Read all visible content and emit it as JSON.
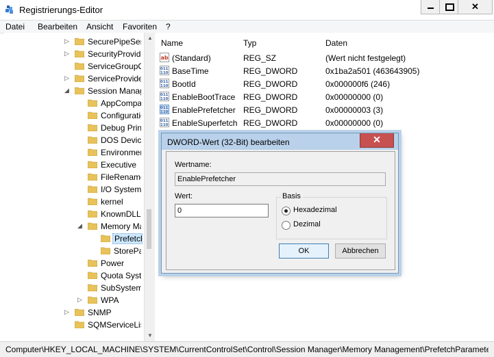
{
  "window": {
    "title": "Registrierungs-Editor",
    "minimize_glyph": "",
    "maximize_glyph": "",
    "close_glyph": "✕"
  },
  "menu": [
    "Datei",
    "Bearbeiten",
    "Ansicht",
    "Favoriten",
    "?"
  ],
  "tree": {
    "items": [
      {
        "label": "SecurePipeServers",
        "expander": "▷"
      },
      {
        "label": "SecurityProviders",
        "expander": "▷"
      },
      {
        "label": "ServiceGroupOrder",
        "expander": ""
      },
      {
        "label": "ServiceProvider",
        "expander": "▷"
      },
      {
        "label": "Session Manager",
        "expander": "◢"
      },
      {
        "label": "AppCompatCache",
        "expander": ""
      },
      {
        "label": "Configuration Manager",
        "expander": ""
      },
      {
        "label": "Debug Print Filter",
        "expander": ""
      },
      {
        "label": "DOS Devices",
        "expander": ""
      },
      {
        "label": "Environment",
        "expander": ""
      },
      {
        "label": "Executive",
        "expander": ""
      },
      {
        "label": "FileRenameOperations",
        "expander": ""
      },
      {
        "label": "I/O System",
        "expander": ""
      },
      {
        "label": "kernel",
        "expander": ""
      },
      {
        "label": "KnownDLLs",
        "expander": ""
      },
      {
        "label": "Memory Management",
        "expander": "◢"
      },
      {
        "label": "PrefetchParameters",
        "expander": ""
      },
      {
        "label": "StoreParameters",
        "expander": ""
      },
      {
        "label": "Power",
        "expander": ""
      },
      {
        "label": "Quota System",
        "expander": ""
      },
      {
        "label": "SubSystems",
        "expander": ""
      },
      {
        "label": "WPA",
        "expander": "▷"
      },
      {
        "label": "SNMP",
        "expander": "▷"
      },
      {
        "label": "SQMServiceList",
        "expander": ""
      }
    ]
  },
  "values_list": {
    "headers": {
      "name": "Name",
      "type": "Typ",
      "data": "Daten"
    },
    "rows": [
      {
        "name": "(Standard)",
        "type": "REG_SZ",
        "data": "(Wert nicht festgelegt)",
        "icon": "string-value-icon"
      },
      {
        "name": "BaseTime",
        "type": "REG_DWORD",
        "data": "0x1ba2a501 (463643905)",
        "icon": "binary-value-icon"
      },
      {
        "name": "BootId",
        "type": "REG_DWORD",
        "data": "0x000000f6 (246)",
        "icon": "binary-value-icon"
      },
      {
        "name": "EnableBootTrace",
        "type": "REG_DWORD",
        "data": "0x00000000 (0)",
        "icon": "binary-value-icon"
      },
      {
        "name": "EnablePrefetcher",
        "type": "REG_DWORD",
        "data": "0x00000003 (3)",
        "icon": "binary-value-icon"
      },
      {
        "name": "EnableSuperfetch",
        "type": "REG_DWORD",
        "data": "0x00000000 (0)",
        "icon": "binary-value-icon"
      }
    ]
  },
  "dialog": {
    "title": "DWORD-Wert (32-Bit) bearbeiten",
    "close_glyph": "✕",
    "name_label": "Wertname:",
    "name_value": "EnablePrefetcher",
    "value_label": "Wert:",
    "value_value": "0",
    "base_label": "Basis",
    "radio_hex": "Hexadezimal",
    "radio_dec": "Dezimal",
    "selected_base": "Hexadezimal",
    "ok_label": "OK",
    "cancel_label": "Abbrechen"
  },
  "statusbar": {
    "path": "Computer\\HKEY_LOCAL_MACHINE\\SYSTEM\\CurrentControlSet\\Control\\Session Manager\\Memory Management\\PrefetchParameters"
  },
  "colors": {
    "dialog_frame": "#b9d1ea",
    "close_red": "#c75050",
    "selection": "#cce8ff",
    "folder_yellow": "#e8c25a"
  }
}
